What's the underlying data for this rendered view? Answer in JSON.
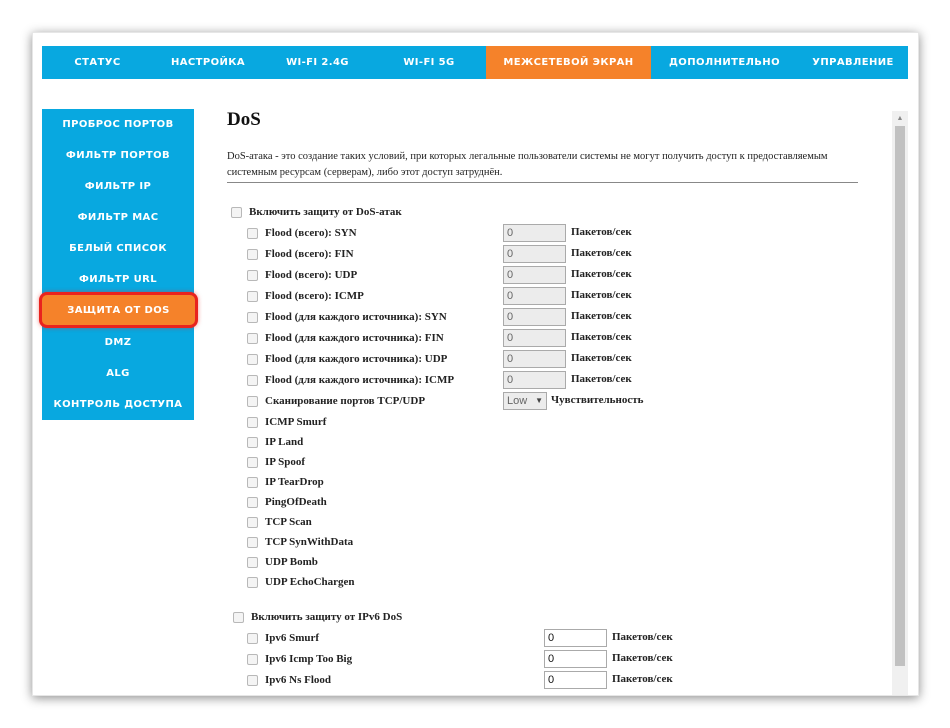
{
  "topnav": {
    "tabs": [
      {
        "label": "СТАТУС",
        "active": false
      },
      {
        "label": "НАСТРОЙКА",
        "active": false
      },
      {
        "label": "WI-FI 2.4G",
        "active": false
      },
      {
        "label": "WI-FI 5G",
        "active": false
      },
      {
        "label": "МЕЖСЕТЕВОЙ ЭКРАН",
        "active": true
      },
      {
        "label": "ДОПОЛНИТЕЛЬНО",
        "active": false
      },
      {
        "label": "УПРАВЛЕНИЕ",
        "active": false
      }
    ]
  },
  "sidebar": {
    "items": [
      {
        "label": "ПРОБРОС ПОРТОВ"
      },
      {
        "label": "ФИЛЬТР ПОРТОВ"
      },
      {
        "label": "ФИЛЬТР IP"
      },
      {
        "label": "ФИЛЬТР MAC"
      },
      {
        "label": "БЕЛЫЙ СПИСОК"
      },
      {
        "label": "ФИЛЬТР URL"
      },
      {
        "label": "ЗАЩИТА ОТ DOS",
        "active": true
      },
      {
        "label": "DMZ"
      },
      {
        "label": "ALG"
      },
      {
        "label": "КОНТРОЛЬ ДОСТУПА"
      }
    ]
  },
  "main": {
    "title": "DoS",
    "description": "DoS-атака - это создание таких условий, при которых легальные пользователи системы не могут получить доступ к предоставляемым системным ресурсам (серверам), либо этот доступ затруднён.",
    "dos_enable_label": "Включить защиту от DoS-атак",
    "flood_rows": [
      {
        "label": "Flood (всего): SYN",
        "value": "0",
        "unit": "Пакетов/сек"
      },
      {
        "label": "Flood (всего): FIN",
        "value": "0",
        "unit": "Пакетов/сек"
      },
      {
        "label": "Flood (всего): UDP",
        "value": "0",
        "unit": "Пакетов/сек"
      },
      {
        "label": "Flood (всего): ICMP",
        "value": "0",
        "unit": "Пакетов/сек"
      },
      {
        "label": "Flood (для каждого источника): SYN",
        "value": "0",
        "unit": "Пакетов/сек"
      },
      {
        "label": "Flood (для каждого источника): FIN",
        "value": "0",
        "unit": "Пакетов/сек"
      },
      {
        "label": "Flood (для каждого источника): UDP",
        "value": "0",
        "unit": "Пакетов/сек"
      },
      {
        "label": "Flood (для каждого источника): ICMP",
        "value": "0",
        "unit": "Пакетов/сек"
      }
    ],
    "port_scan": {
      "label": "Сканирование портов TCP/UDP",
      "selected": "Low",
      "sensitivity_label": "Чувствительность"
    },
    "simple_options": [
      {
        "label": "ICMP Smurf"
      },
      {
        "label": "IP Land"
      },
      {
        "label": "IP Spoof"
      },
      {
        "label": "IP TearDrop"
      },
      {
        "label": "PingOfDeath"
      },
      {
        "label": "TCP Scan"
      },
      {
        "label": "TCP SynWithData"
      },
      {
        "label": "UDP Bomb"
      },
      {
        "label": "UDP EchoChargen"
      }
    ],
    "ipv6_enable_label": "Включить защиту от IPv6 DoS",
    "ipv6_rows": [
      {
        "label": "Ipv6 Smurf",
        "value": "0",
        "unit": "Пакетов/сек"
      },
      {
        "label": "Ipv6 Icmp Too Big",
        "value": "0",
        "unit": "Пакетов/сек"
      },
      {
        "label": "Ipv6 Ns Flood",
        "value": "0",
        "unit": "Пакетов/сек"
      }
    ]
  },
  "colors": {
    "nav_blue": "#08a8e0",
    "active_orange": "#f5822a",
    "highlight_red": "#e8231e"
  }
}
